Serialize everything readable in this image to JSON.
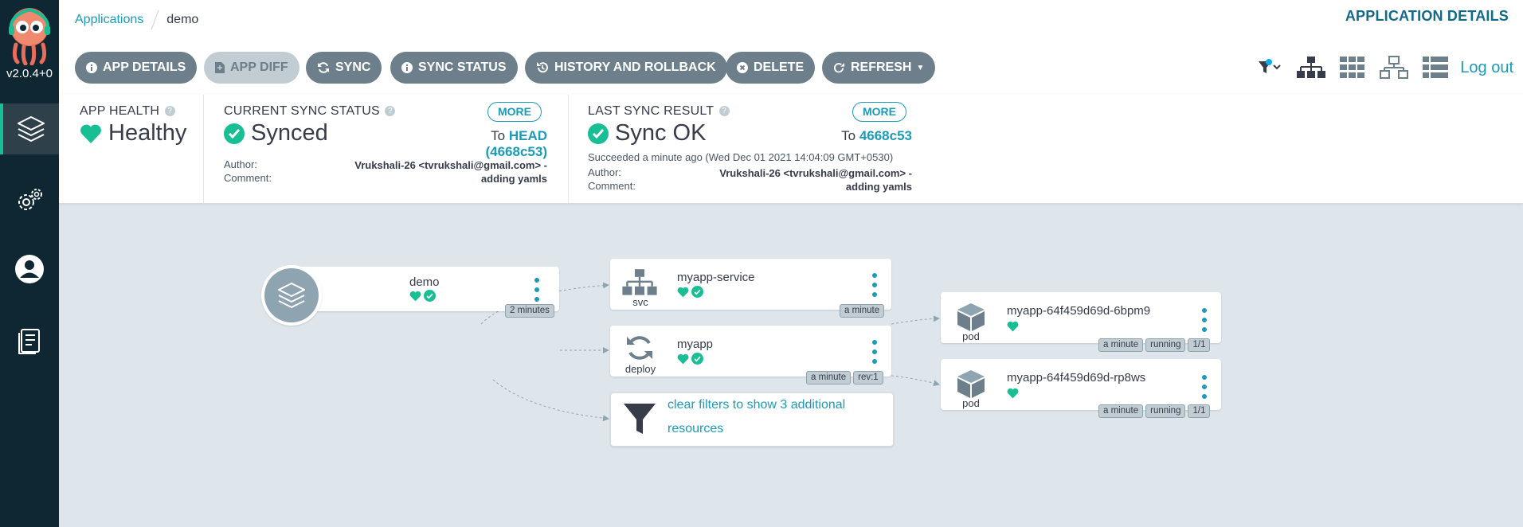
{
  "sidebar": {
    "version": "v2.0.4+0",
    "nav": [
      "applications",
      "settings",
      "user-info",
      "documentation"
    ]
  },
  "breadcrumb": {
    "parent": "Applications",
    "current": "demo"
  },
  "page_title": "APPLICATION DETAILS",
  "toolbar": {
    "buttons": [
      {
        "label": "APP DETAILS",
        "icon": "info-icon",
        "enabled": true
      },
      {
        "label": "APP DIFF",
        "icon": "file-icon",
        "enabled": false
      },
      {
        "label": "SYNC",
        "icon": "sync-icon",
        "enabled": true
      },
      {
        "label": "SYNC STATUS",
        "icon": "info-icon",
        "enabled": true
      },
      {
        "label": "HISTORY AND ROLLBACK",
        "icon": "history-icon",
        "enabled": true
      },
      {
        "label": "DELETE",
        "icon": "times-circle-icon",
        "enabled": true
      },
      {
        "label": "REFRESH",
        "icon": "refresh-icon",
        "enabled": true
      }
    ],
    "logout": "Log out"
  },
  "status": {
    "health": {
      "label": "APP HEALTH",
      "value": "Healthy"
    },
    "current_sync": {
      "label": "CURRENT SYNC STATUS",
      "value": "Synced",
      "more": "MORE",
      "to_prefix": "To",
      "revision": "HEAD (4668c53)",
      "author_label": "Author:",
      "comment_label": "Comment:",
      "author": "Vrukshali-26 <tvrukshali@gmail.com> -",
      "comment": "adding yamls"
    },
    "last_sync": {
      "label": "LAST SYNC RESULT",
      "value": "Sync OK",
      "more": "MORE",
      "to_prefix": "To",
      "revision": "4668c53",
      "succeeded": "Succeeded a minute ago (Wed Dec 01 2021 14:04:09 GMT+0530)",
      "author_label": "Author:",
      "comment_label": "Comment:",
      "author": "Vrukshali-26 <tvrukshali@gmail.com> -",
      "comment": "adding yamls"
    }
  },
  "graph": {
    "app": {
      "name": "demo",
      "age": "2 minutes"
    },
    "service": {
      "name": "myapp-service",
      "kind": "svc",
      "age": "a minute"
    },
    "deployment": {
      "name": "myapp",
      "kind": "deploy",
      "age": "a minute",
      "rev": "rev:1"
    },
    "filter": {
      "line1": "clear filters to show 3 additional",
      "line2": "resources"
    },
    "pods": [
      {
        "name": "myapp-64f459d69d-6bpm9",
        "kind": "pod",
        "age": "a minute",
        "state": "running",
        "ready": "1/1"
      },
      {
        "name": "myapp-64f459d69d-rp8ws",
        "kind": "pod",
        "age": "a minute",
        "state": "running",
        "ready": "1/1"
      }
    ]
  },
  "colors": {
    "accent": "#1b9bb7",
    "healthy": "#18be94",
    "sidebar": "#0f2733",
    "button": "#6d7f8b"
  }
}
